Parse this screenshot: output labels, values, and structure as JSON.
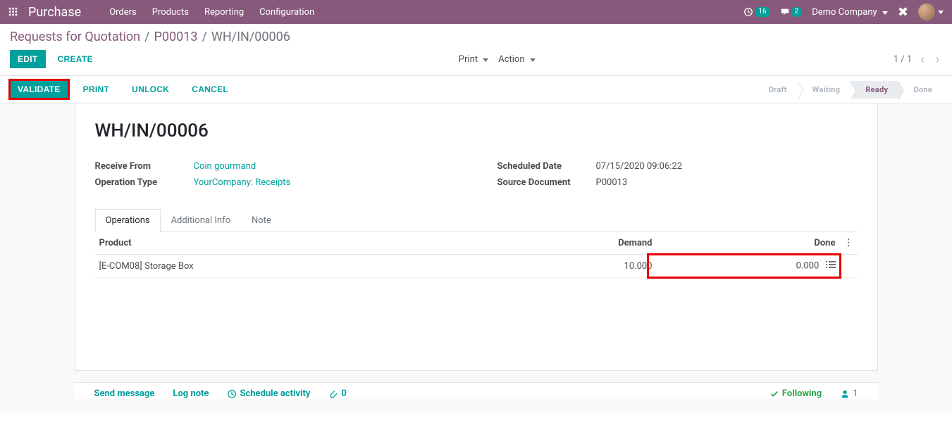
{
  "topbar": {
    "app_title": "Purchase",
    "menu": [
      "Orders",
      "Products",
      "Reporting",
      "Configuration"
    ],
    "clock_badge": "16",
    "chat_badge": "2",
    "company": "Demo Company"
  },
  "breadcrumb": {
    "items": [
      "Requests for Quotation",
      "P00013"
    ],
    "current": "WH/IN/00006"
  },
  "cp": {
    "edit": "Edit",
    "create": "Create",
    "print": "Print",
    "action": "Action",
    "pager": "1 / 1"
  },
  "statusbar": {
    "validate": "Validate",
    "print": "Print",
    "unlock": "Unlock",
    "cancel": "Cancel",
    "states": [
      "Draft",
      "Waiting",
      "Ready",
      "Done"
    ],
    "active_index": 2
  },
  "record": {
    "title": "WH/IN/00006",
    "receive_from_label": "Receive From",
    "receive_from": "Coin gourmand",
    "operation_type_label": "Operation Type",
    "operation_type": "YourCompany: Receipts",
    "scheduled_date_label": "Scheduled Date",
    "scheduled_date": "07/15/2020 09:06:22",
    "source_doc_label": "Source Document",
    "source_doc": "P00013"
  },
  "tabs": {
    "operations": "Operations",
    "addl_info": "Additional Info",
    "note": "Note"
  },
  "table": {
    "headers": {
      "product": "Product",
      "demand": "Demand",
      "done": "Done"
    },
    "rows": [
      {
        "product": "[E-COM08] Storage Box",
        "demand": "10.000",
        "done": "0.000"
      }
    ]
  },
  "chatter": {
    "send": "Send message",
    "log": "Log note",
    "schedule": "Schedule activity",
    "attach_count": "0",
    "following": "Following",
    "follower_count": "1"
  }
}
